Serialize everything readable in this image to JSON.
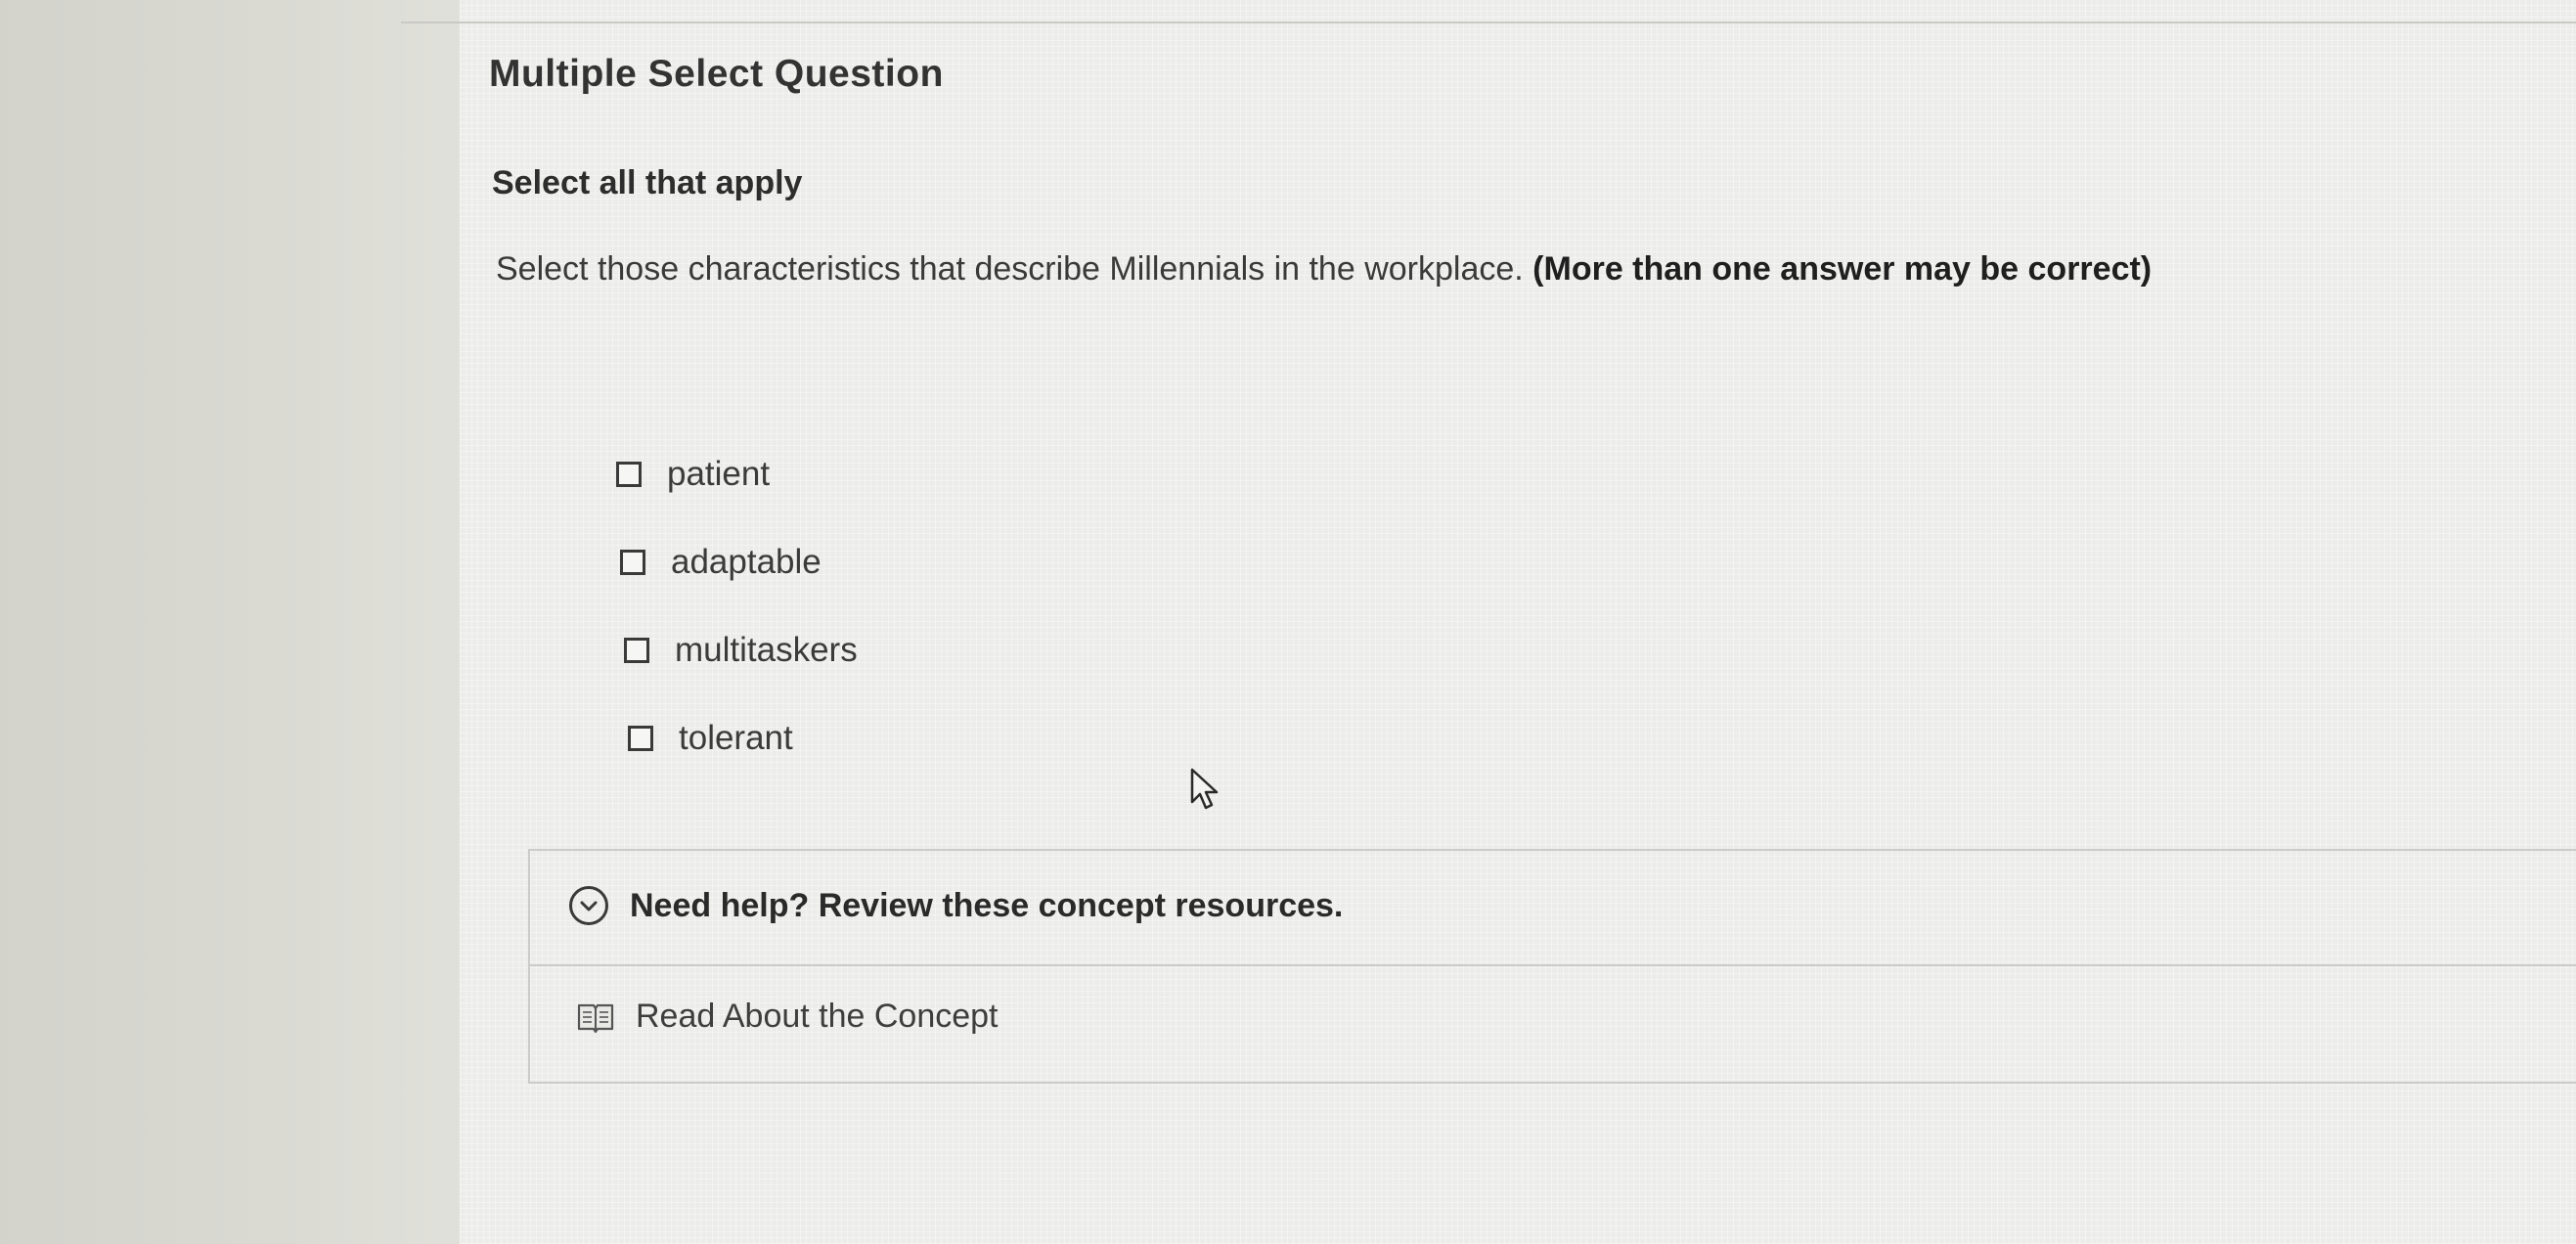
{
  "question": {
    "type_label": "Multiple Select Question",
    "instruction": "Select all that apply",
    "prompt_text": "Select those characteristics that describe Millennials in the workplace. ",
    "prompt_emphasis": "(More than one answer may be correct)"
  },
  "options": [
    {
      "label": "patient",
      "checked": false
    },
    {
      "label": "adaptable",
      "checked": false
    },
    {
      "label": "multitaskers",
      "checked": false
    },
    {
      "label": "tolerant",
      "checked": false
    }
  ],
  "help": {
    "title": "Need help? Review these concept resources.",
    "icon": "chevron-down-circle-icon",
    "resources": [
      {
        "label": "Read About the Concept",
        "icon": "book-icon"
      }
    ]
  }
}
